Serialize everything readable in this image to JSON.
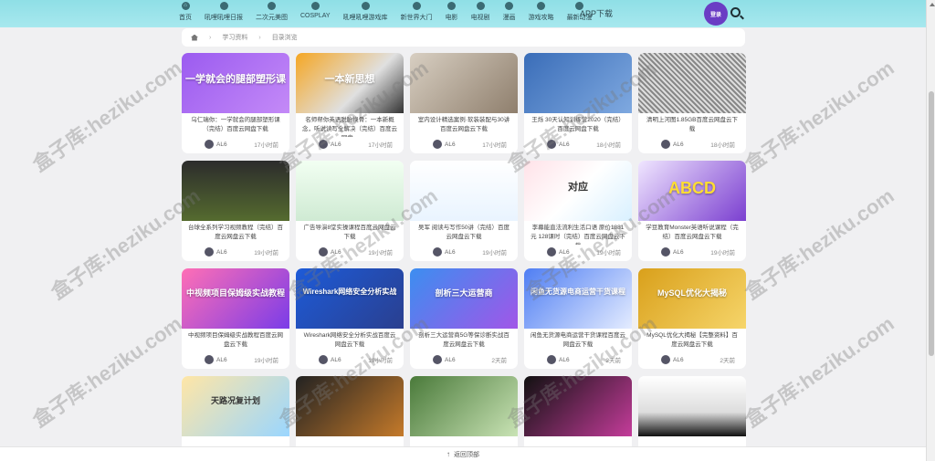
{
  "nav": {
    "items": [
      {
        "label": "首页",
        "icon": "home-icon"
      },
      {
        "label": "吼哩吼哩日报",
        "icon": "calendar-icon"
      },
      {
        "label": "二次元美图",
        "icon": "image-icon"
      },
      {
        "label": "COSPLAY",
        "icon": "camera-icon"
      },
      {
        "label": "吼哩吼哩游戏库",
        "icon": "gamepad-icon"
      },
      {
        "label": "新世界大门",
        "icon": "plane-icon"
      },
      {
        "label": "电影",
        "icon": "film-icon"
      },
      {
        "label": "电视剧",
        "icon": "tv-icon"
      },
      {
        "label": "漫画",
        "icon": "book-icon"
      },
      {
        "label": "游戏攻略",
        "icon": "guide-icon"
      },
      {
        "label": "最新动漫",
        "icon": "anime-icon"
      }
    ],
    "app_download": "APP下载",
    "login": "登录"
  },
  "breadcrumb": {
    "items": [
      "学习资料",
      "目录浏览"
    ]
  },
  "cards": [
    {
      "thumb_text": "一学就会的腿部塑形课",
      "title": "乌仁瑞你：一学就会的腿部塑形课（完结）百度云网盘下载",
      "author": "AL6",
      "time": "17小时前"
    },
    {
      "thumb_text": "一本新思想",
      "title": "名师帮你英语脱胎换骨：一本新概念，听说读写全解决（完结）百度云网盘...",
      "author": "AL6",
      "time": "17小时前"
    },
    {
      "thumb_text": "",
      "title": "室内设计精选案例·软装装配与30讲百度云网盘云下载",
      "author": "AL6",
      "time": "17小时前"
    },
    {
      "thumb_text": "",
      "title": "王烁 30天认知训练营2020（完结）百度云网盘下载",
      "author": "AL6",
      "time": "18小时前"
    },
    {
      "thumb_text": "",
      "title": "清明上河图1.85GB百度云网盘云下载",
      "author": "AL6",
      "time": "18小时前"
    },
    {
      "thumb_text": "",
      "title": "台球全系列学习视频教程（完结）百度云网盘云下载",
      "author": "AL6",
      "time": "19小时前"
    },
    {
      "thumb_text": "",
      "title": "广告导演8堂实操课程百度云网盘云下载",
      "author": "AL6",
      "time": "19小时前"
    },
    {
      "thumb_text": "",
      "title": "吴军 阅读与写作50讲（完结）百度云网盘云下载",
      "author": "AL6",
      "time": "19小时前"
    },
    {
      "thumb_text": "对应",
      "title": "李幕能直法流利生活口语 原价1881元 128课时（完结）百度云网盘云下载",
      "author": "AL6",
      "time": "19小时前"
    },
    {
      "thumb_text": "ABCD",
      "title": "学豆教育Monster英语听说课程（完结）百度云网盘云下载",
      "author": "AL6",
      "time": "19小时前"
    },
    {
      "thumb_text": "中视频项目保姆级实战教程",
      "title": "中视频项目保姆级实战教程百度云网盘云下载",
      "author": "AL6",
      "time": "19小时前"
    },
    {
      "thumb_text": "Wireshark网络安全分析实战",
      "title": "Wireshark网络安全分析实战百度云网盘云下载",
      "author": "AL6",
      "time": "19小时前"
    },
    {
      "thumb_text": "剖析三大运营商",
      "title": "剖析三大运营商5G等保诊断实战百度云网盘云下载",
      "author": "AL6",
      "time": "2天前"
    },
    {
      "thumb_text": "闲鱼无货源电商运营干货课程",
      "title": "闲鱼无货源电商运营干货课程百度云网盘云下载",
      "author": "AL6",
      "time": "2天前"
    },
    {
      "thumb_text": "MySQL优化大揭秘",
      "title": "MySQL优化大揭秘【完整资料】百度云网盘云下载",
      "author": "AL6",
      "time": "2天前"
    },
    {
      "thumb_text": "天路况复计划",
      "title": "",
      "author": "",
      "time": ""
    },
    {
      "thumb_text": "",
      "title": "",
      "author": "",
      "time": ""
    },
    {
      "thumb_text": "",
      "title": "",
      "author": "",
      "time": ""
    },
    {
      "thumb_text": "",
      "title": "",
      "author": "",
      "time": ""
    },
    {
      "thumb_text": "",
      "title": "",
      "author": "",
      "time": ""
    }
  ],
  "back_to_top": "返回顶部",
  "watermark": "盒子库:heziku.com",
  "colors": {
    "nav_bg": "#a7e8ee",
    "login_btn": "#6a3cc4",
    "page_bg": "#f0f0f2"
  }
}
